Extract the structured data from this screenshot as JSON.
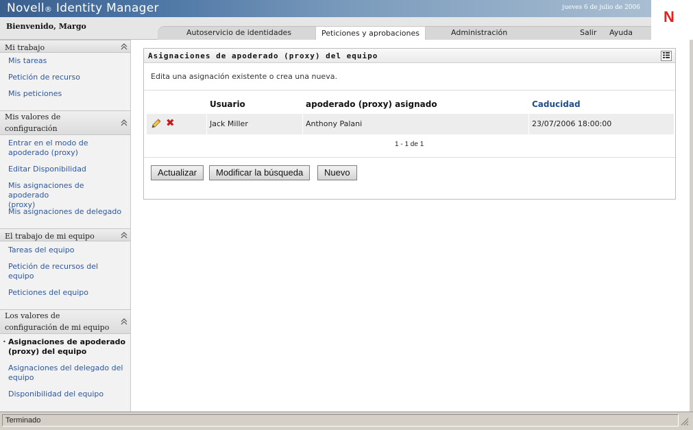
{
  "header": {
    "brand": "Novell",
    "brand_mark": "®",
    "product": "Identity Manager",
    "date": "jueves 6 de julio de 2006",
    "logo": "N",
    "welcome": "Bienvenido, Margo",
    "tabs": [
      {
        "label": "Autoservicio de identidades"
      },
      {
        "label": "Peticiones y aprobaciones"
      },
      {
        "label": "Administración"
      }
    ],
    "util_links": [
      {
        "label": "Salir"
      },
      {
        "label": "Ayuda"
      }
    ]
  },
  "sidebar": {
    "sections": [
      {
        "title": "Mi trabajo",
        "items": [
          "Mis tareas",
          "Petición de recurso",
          "Mis peticiones"
        ]
      },
      {
        "title_line1": "Mis valores de",
        "title_line2": "configuración",
        "items": [
          "Entrar en el modo de",
          "apoderado (proxy)",
          "Editar Disponibilidad",
          "Mis asignaciones de apoderado",
          "(proxy)",
          "Mis asignaciones de delegado"
        ]
      },
      {
        "title": "El trabajo de mi equipo",
        "items": [
          "Tareas del equipo",
          "Petición de recursos del",
          "equipo",
          "Peticiones del equipo"
        ]
      },
      {
        "title_line1": "Los valores de",
        "title_line2": "configuración de mi equipo",
        "items": [
          "Asignaciones de apoderado",
          "(proxy) del equipo",
          "Asignaciones del delegado del",
          "equipo",
          "Disponibilidad del equipo"
        ]
      }
    ]
  },
  "panel": {
    "title": "Asignaciones de apoderado (proxy) del equipo",
    "description": "Edita una asignación existente o crea una nueva.",
    "columns": [
      "Usuario",
      "apoderado (proxy) asignado",
      "Caducidad"
    ],
    "rows": [
      {
        "user": "Jack Miller",
        "proxy": "Anthony Palani",
        "expires": "23/07/2006 18:00:00"
      }
    ],
    "pager": "1 - 1 de 1",
    "buttons": {
      "refresh": "Actualizar",
      "modify_search": "Modificar la búsqueda",
      "new": "Nuevo"
    }
  },
  "status": {
    "text": "Terminado"
  },
  "colors": {
    "link": "#2b57a1",
    "brand_bar": "#4f78a6",
    "logo": "#e8221b",
    "delete": "#c31c1c"
  },
  "icons": [
    "edit-pencil-icon",
    "delete-x-icon",
    "collapse-chevron-icon",
    "panel-menu-icon",
    "resize-grip-icon"
  ]
}
